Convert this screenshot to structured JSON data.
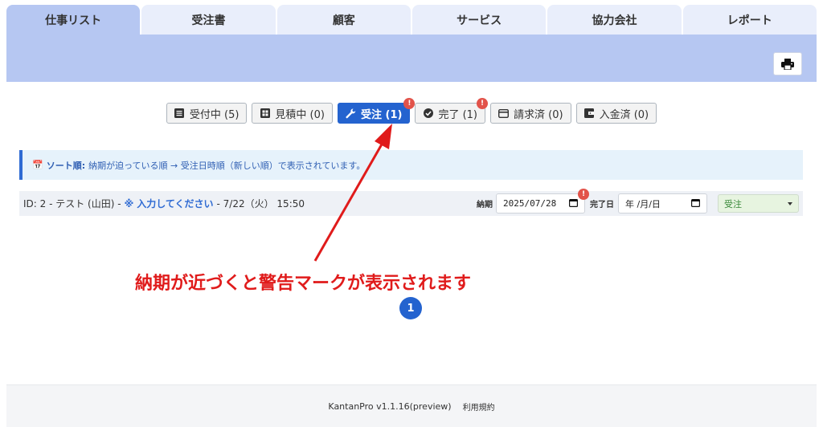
{
  "tabs": [
    {
      "label": "仕事リスト",
      "active": true
    },
    {
      "label": "受注書",
      "active": false
    },
    {
      "label": "顧客",
      "active": false
    },
    {
      "label": "サービス",
      "active": false
    },
    {
      "label": "協力会社",
      "active": false
    },
    {
      "label": "レポート",
      "active": false
    }
  ],
  "toolbar": {
    "print_icon": "printer-icon"
  },
  "filters": [
    {
      "label": "受付中 (5)",
      "icon": "list-icon",
      "active": false,
      "warning": false
    },
    {
      "label": "見積中 (0)",
      "icon": "calculator-icon",
      "active": false,
      "warning": false
    },
    {
      "label": "受注 (1)",
      "icon": "wrench-icon",
      "active": true,
      "warning": true
    },
    {
      "label": "完了 (1)",
      "icon": "check-circle-icon",
      "active": false,
      "warning": true
    },
    {
      "label": "請求済 (0)",
      "icon": "card-icon",
      "active": false,
      "warning": false
    },
    {
      "label": "入金済 (0)",
      "icon": "wallet-icon",
      "active": false,
      "warning": false
    }
  ],
  "warning_mark": "!",
  "sort_info": {
    "icon": "📅",
    "label": "ソート順:",
    "text": "納期が迫っている順 → 受注日時順（新しい順）で表示されています。"
  },
  "job_row": {
    "prefix": "ID: 2 - テスト (山田) - ",
    "mark": "※",
    "link_text": "入力してください",
    "suffix": "- 7/22（火）  15:50",
    "due_label": "納期",
    "due_value": "2025/07/28",
    "complete_label": "完了日",
    "complete_value": "年 /月/日",
    "status_value": "受注"
  },
  "annotation": "納期が近づくと警告マークが表示されます",
  "pagination": {
    "current": "1"
  },
  "footer": {
    "version": "KantanPro v1.1.16(preview)",
    "terms": "利用規約"
  },
  "colors": {
    "accent": "#2463cf",
    "tab_band": "#b6c7f2",
    "warning": "#e2534a",
    "annotation": "#e01b1b"
  }
}
